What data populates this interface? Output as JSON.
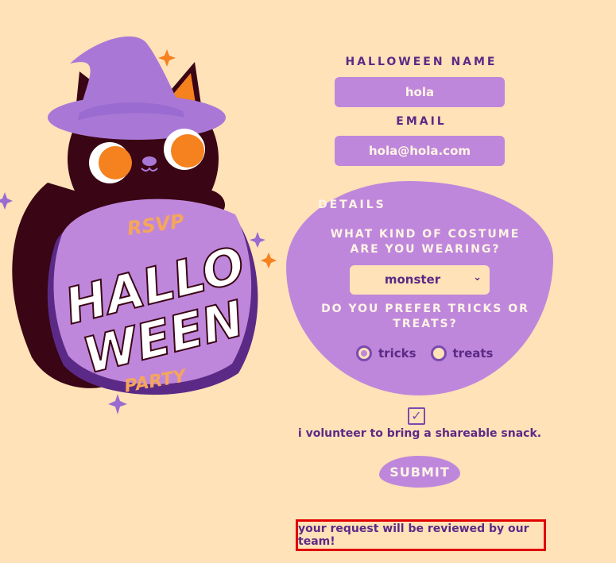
{
  "colors": {
    "background": "#FFE2B8",
    "accent_purple": "#BF87DB",
    "dark_purple": "#5B2A86",
    "cream_text": "#FFF4E6",
    "orange": "#F5811F",
    "cat_dark": "#3A0514",
    "highlight_red": "#E00000"
  },
  "illustration": {
    "rsvp": "RSVP",
    "line1": "HALLO",
    "line2": "WEEN",
    "party": "PARTY"
  },
  "form": {
    "name_label": "HALLOWEEN NAME",
    "name_value": "hola",
    "email_label": "EMAIL",
    "email_value": "hola@hola.com",
    "details_title": "DETAILS",
    "costume_question": "WHAT KIND OF COSTUME ARE YOU WEARING?",
    "costume_selected": "monster",
    "preference_question": "DO YOU PREFER TRICKS OR TREATS?",
    "option_tricks": "tricks",
    "option_treats": "treats",
    "selected_option": "tricks",
    "snack_checked": true,
    "snack_label": "i volunteer to bring a shareable snack.",
    "submit_label": "SUBMIT"
  },
  "notice": "your request will be reviewed by our team!"
}
